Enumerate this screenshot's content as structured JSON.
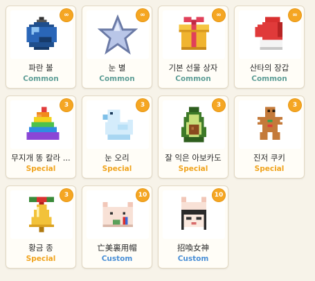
{
  "colors": {
    "common": "#5f9e97",
    "special": "#f0a31c",
    "custom": "#4a8fd6",
    "badge": "#f5a623"
  },
  "items": [
    {
      "name": "파란 볼",
      "rarity": "Common",
      "badge": "∞",
      "icon": "blue-ornament-icon"
    },
    {
      "name": "눈 별",
      "rarity": "Common",
      "badge": "∞",
      "icon": "snow-star-icon"
    },
    {
      "name": "기본 선물 상자",
      "rarity": "Common",
      "badge": "∞",
      "icon": "gift-box-icon"
    },
    {
      "name": "산타의 장갑",
      "rarity": "Common",
      "badge": "∞",
      "icon": "santa-mitten-icon"
    },
    {
      "name": "무지개 똥 칼라 ...",
      "rarity": "Special",
      "badge": "3",
      "icon": "rainbow-poop-icon"
    },
    {
      "name": "눈 오리",
      "rarity": "Special",
      "badge": "3",
      "icon": "snow-duck-icon"
    },
    {
      "name": "잘 익은 아보카도",
      "rarity": "Special",
      "badge": "3",
      "icon": "avocado-icon"
    },
    {
      "name": "진저 쿠키",
      "rarity": "Special",
      "badge": "3",
      "icon": "gingerbread-cookie-icon"
    },
    {
      "name": "황금 종",
      "rarity": "Special",
      "badge": "3",
      "icon": "golden-bell-icon"
    },
    {
      "name": "亡美裏用帽",
      "rarity": "Custom",
      "badge": "10",
      "icon": "cat-hat-icon"
    },
    {
      "name": "招喚女神",
      "rarity": "Custom",
      "badge": "10",
      "icon": "cat-hat-girl-icon"
    }
  ]
}
